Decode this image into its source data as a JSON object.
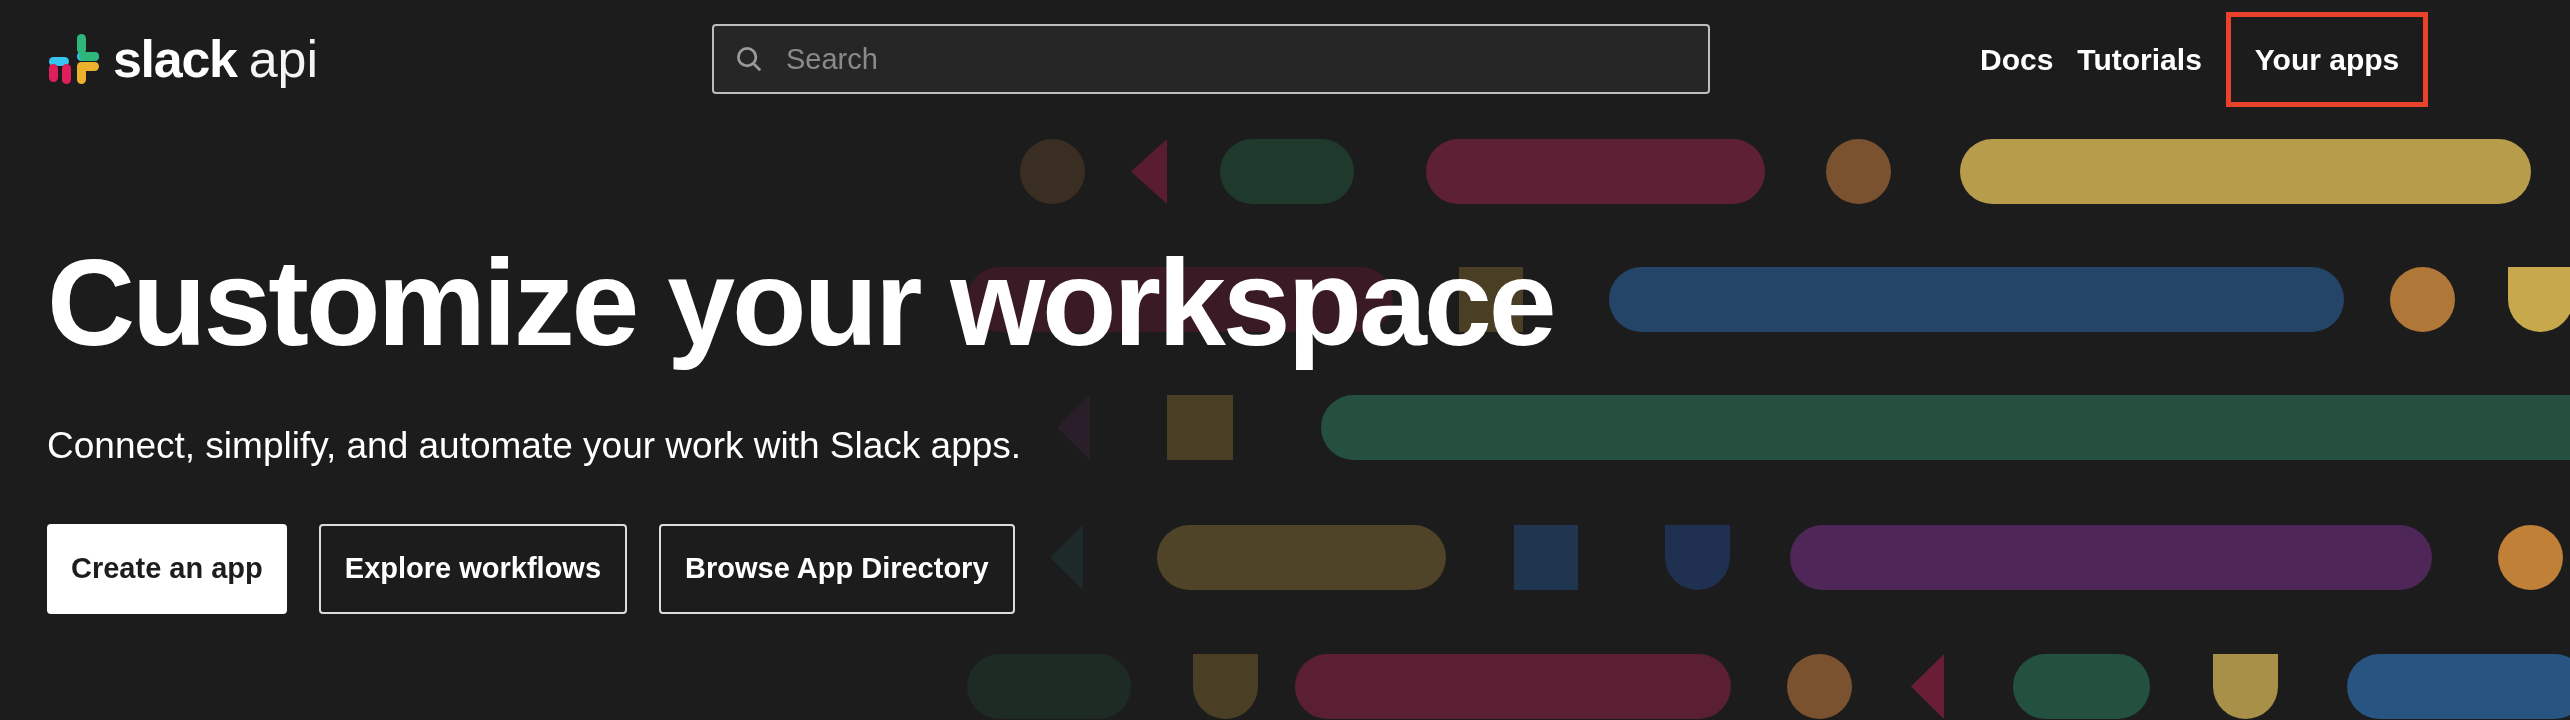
{
  "logo": {
    "word": "slack",
    "suffix": "api"
  },
  "search": {
    "placeholder": "Search"
  },
  "nav": [
    {
      "label": "Docs",
      "highlighted": false
    },
    {
      "label": "Tutorials",
      "highlighted": false
    },
    {
      "label": "Your apps",
      "highlighted": true
    }
  ],
  "hero": {
    "title": "Customize your workspace",
    "subtitle": "Connect, simplify, and automate your work with Slack apps.",
    "buttons": [
      {
        "label": "Create an app",
        "kind": "primary"
      },
      {
        "label": "Explore workflows",
        "kind": "outline"
      },
      {
        "label": "Browse App Directory",
        "kind": "outline"
      }
    ]
  }
}
